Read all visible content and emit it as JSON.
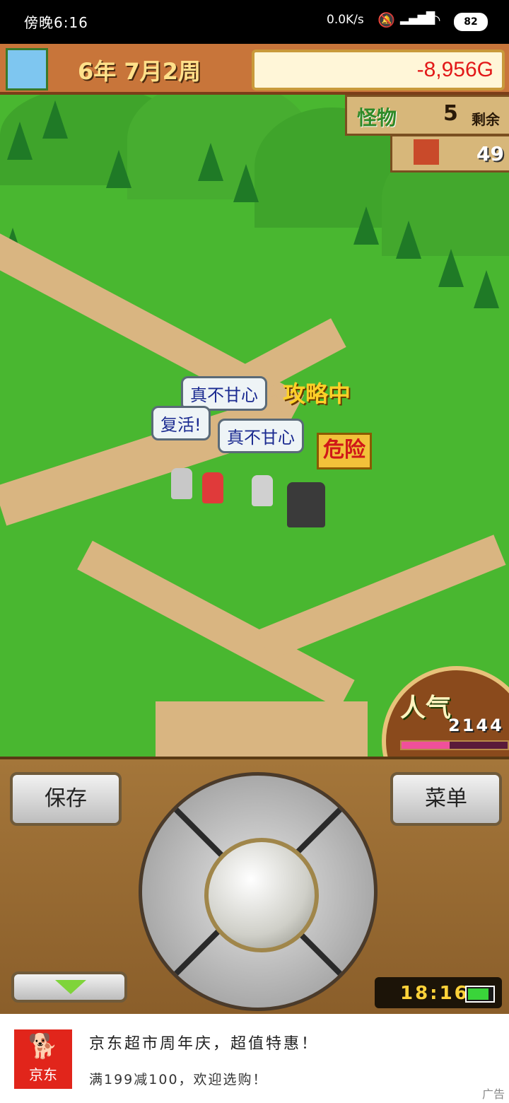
{
  "status_bar": {
    "time": "傍晚6:16",
    "net_speed": "0.0K/s",
    "battery": "82"
  },
  "hud": {
    "date": "6年 7月2周",
    "money": "-8,956G",
    "monster_label": "怪物",
    "monster_count": "5",
    "monster_suffix": "剩余",
    "town_value": "49"
  },
  "scene": {
    "bubbles": [
      "复活!",
      "真不甘心",
      "真不甘心"
    ],
    "capture_label": "攻略中",
    "danger_label": "危险",
    "popularity_label": "人气",
    "popularity_value": "2144",
    "popularity_fill": 0.45
  },
  "controls": {
    "save_label": "保存",
    "menu_label": "菜单",
    "clock": "18:16",
    "device_battery_fill": 0.85
  },
  "ad": {
    "logo_text": "京东",
    "title": "京东超市周年庆，超值特惠！",
    "subtitle": "满199减100，欢迎选购！",
    "tag": "广告"
  },
  "colors": {
    "money": "#e21818",
    "grass": "#49b730",
    "path": "#d9b581"
  }
}
